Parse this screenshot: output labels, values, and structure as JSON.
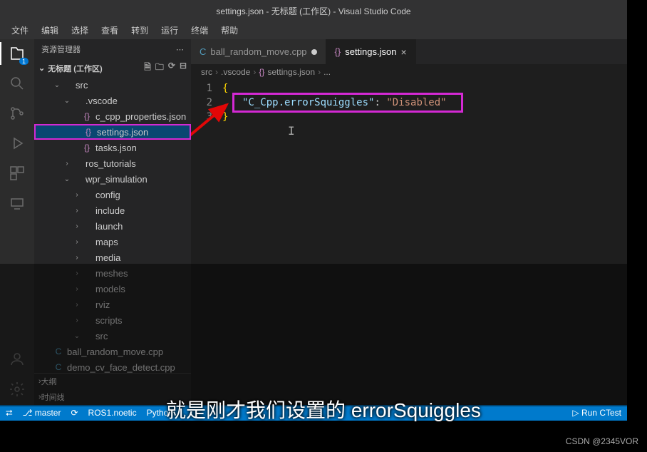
{
  "title": "settings.json - 无标题 (工作区) - Visual Studio Code",
  "menu": [
    "文件",
    "编辑",
    "选择",
    "查看",
    "转到",
    "运行",
    "终端",
    "帮助"
  ],
  "activitybar": {
    "badge_explorer": "1"
  },
  "sidebar": {
    "header": "资源管理器",
    "workspace": "无标题 (工作区)",
    "tree": [
      {
        "t": "folder",
        "n": "src",
        "d": 1,
        "open": true
      },
      {
        "t": "folder",
        "n": ".vscode",
        "d": 2,
        "open": true
      },
      {
        "t": "file",
        "n": "c_cpp_properties.json",
        "d": 3,
        "i": "{}"
      },
      {
        "t": "file",
        "n": "settings.json",
        "d": 3,
        "i": "{}",
        "sel": true
      },
      {
        "t": "file",
        "n": "tasks.json",
        "d": 3,
        "i": "{}"
      },
      {
        "t": "folder",
        "n": "ros_tutorials",
        "d": 2,
        "open": false
      },
      {
        "t": "folder",
        "n": "wpr_simulation",
        "d": 2,
        "open": true
      },
      {
        "t": "folder",
        "n": "config",
        "d": 3,
        "open": false
      },
      {
        "t": "folder",
        "n": "include",
        "d": 3,
        "open": false
      },
      {
        "t": "folder",
        "n": "launch",
        "d": 3,
        "open": false
      },
      {
        "t": "folder",
        "n": "maps",
        "d": 3,
        "open": false
      },
      {
        "t": "folder",
        "n": "media",
        "d": 3,
        "open": false
      },
      {
        "t": "folder",
        "n": "meshes",
        "d": 3,
        "open": false
      },
      {
        "t": "folder",
        "n": "models",
        "d": 3,
        "open": false
      },
      {
        "t": "folder",
        "n": "rviz",
        "d": 3,
        "open": false
      },
      {
        "t": "folder",
        "n": "scripts",
        "d": 3,
        "open": false
      },
      {
        "t": "folder",
        "n": "src",
        "d": 3,
        "open": true
      },
      {
        "t": "file",
        "n": "ball_random_move.cpp",
        "d": 4,
        "i": "C"
      },
      {
        "t": "file",
        "n": "demo_cv_face_detect.cpp",
        "d": 4,
        "i": "C"
      }
    ],
    "sections": [
      "大纲",
      "时间线"
    ]
  },
  "tabs": [
    {
      "icon": "C",
      "label": "ball_random_move.cpp",
      "dirty": true,
      "active": false
    },
    {
      "icon": "{}",
      "label": "settings.json",
      "dirty": false,
      "active": true
    }
  ],
  "breadcrumb": [
    "src",
    ".vscode",
    "{} settings.json",
    "..."
  ],
  "code": {
    "lines": [
      "1",
      "2",
      "3"
    ],
    "l1": "{",
    "key": "\"C_Cpp.errorSquiggles\"",
    "colon": ": ",
    "val": "\"Disabled\"",
    "l3": "}"
  },
  "statusbar": {
    "left": [
      "master",
      "ROS1.noetic",
      "Python"
    ],
    "right": [
      "Run CTest"
    ]
  },
  "subtitle": "就是刚才我们设置的 errorSquiggles",
  "watermark": "CSDN @2345VOR"
}
